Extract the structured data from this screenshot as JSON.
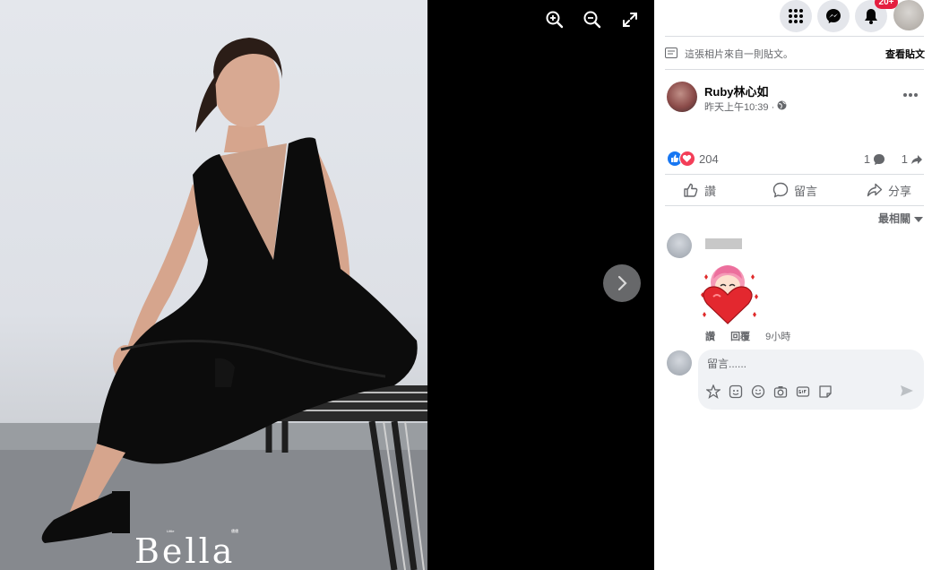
{
  "viewer": {
    "brand_text": "Bella",
    "brand_small_left": "Little",
    "brand_small_right": "儂儂",
    "tools": [
      "zoom-in-icon",
      "zoom-out-icon",
      "fullscreen-icon"
    ]
  },
  "topbar": {
    "notification_badge": "20+"
  },
  "post": {
    "info_text": "這張相片來自一則貼文。",
    "info_link": "查看貼文",
    "author": "Ruby林心如",
    "time": "昨天上午10:39 ·",
    "reaction_count": "204",
    "comment_count": "1",
    "share_count": "1"
  },
  "actions": {
    "like": "讚",
    "comment": "留言",
    "share": "分享"
  },
  "comments": {
    "sort_label": "最相關",
    "items": [
      {
        "like_label": "讚",
        "reply_label": "回覆",
        "time": "9小時"
      }
    ],
    "composer_placeholder": "留言......"
  },
  "colors": {
    "accent": "#1877f2",
    "love": "#f33e58",
    "badge": "#e41e3f"
  }
}
